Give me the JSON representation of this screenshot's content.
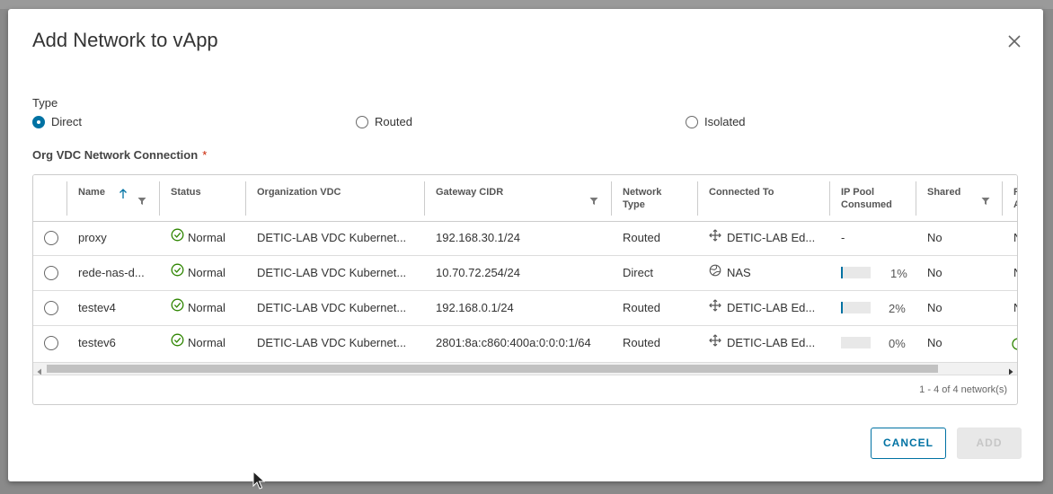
{
  "dialog": {
    "title": "Add Network to vApp"
  },
  "type": {
    "label": "Type",
    "options": [
      {
        "label": "Direct",
        "selected": true
      },
      {
        "label": "Routed",
        "selected": false
      },
      {
        "label": "Isolated",
        "selected": false
      }
    ]
  },
  "network_connection": {
    "label": "Org VDC Network Connection",
    "required_mark": "*"
  },
  "table": {
    "columns": {
      "name": "Name",
      "status": "Status",
      "org_vdc": "Organization VDC",
      "gateway_cidr": "Gateway CIDR",
      "network_type_1": "Network",
      "network_type_2": "Type",
      "connected_to": "Connected To",
      "ip_pool_1": "IP Pool",
      "ip_pool_2": "Consumed",
      "shared": "Shared",
      "partial_1": "R",
      "partial_2": "A"
    },
    "rows": [
      {
        "name": "proxy",
        "status": "Normal",
        "org_vdc": "DETIC-LAB VDC Kubernet...",
        "gateway_cidr": "192.168.30.1/24",
        "network_type": "Routed",
        "connected_to": "DETIC-LAB Ed...",
        "connected_icon": "edge-gateway-icon",
        "ip_pool_text": "-",
        "shared": "No",
        "partial": "N"
      },
      {
        "name": "rede-nas-d...",
        "status": "Normal",
        "org_vdc": "DETIC-LAB VDC Kubernet...",
        "gateway_cidr": "10.70.72.254/24",
        "network_type": "Direct",
        "connected_to": "NAS",
        "connected_icon": "external-network-icon",
        "ip_pool_pct": "1%",
        "ip_pool_fraction": 0.01,
        "shared": "No",
        "partial": "N"
      },
      {
        "name": "testev4",
        "status": "Normal",
        "org_vdc": "DETIC-LAB VDC Kubernet...",
        "gateway_cidr": "192.168.0.1/24",
        "network_type": "Routed",
        "connected_to": "DETIC-LAB Ed...",
        "connected_icon": "edge-gateway-icon",
        "ip_pool_pct": "2%",
        "ip_pool_fraction": 0.02,
        "shared": "No",
        "partial": "N"
      },
      {
        "name": "testev6",
        "status": "Normal",
        "org_vdc": "DETIC-LAB VDC Kubernet...",
        "gateway_cidr": "2801:8a:c860:400a:0:0:0:1/64",
        "network_type": "Routed",
        "connected_to": "DETIC-LAB Ed...",
        "connected_icon": "edge-gateway-icon",
        "ip_pool_pct": "0%",
        "ip_pool_fraction": 0.0,
        "shared": "No",
        "partial": ""
      }
    ],
    "footer": "1 - 4 of 4 network(s)"
  },
  "buttons": {
    "cancel": "CANCEL",
    "add": "ADD"
  },
  "colors": {
    "accent": "#0072a3",
    "success": "#2e8500",
    "required": "#c92100"
  }
}
